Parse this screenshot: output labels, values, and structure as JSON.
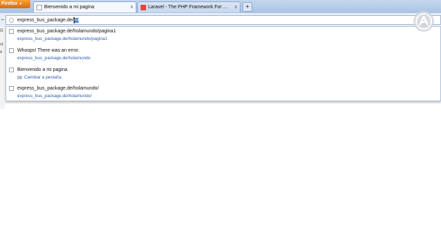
{
  "browser": {
    "menu_button": "Firefox",
    "tabs": [
      {
        "label": "Bienvenido a mi pagina",
        "active": true
      },
      {
        "label": "Laravel - The PHP Framework For We...",
        "active": false
      }
    ],
    "new_tab": "+",
    "close_glyph": "x"
  },
  "urlbar": {
    "typed_before": "express_bus_package.de/",
    "typed_selected": "ro"
  },
  "suggestions": [
    {
      "title": "express_bus_package.de/holamundo/pagina1",
      "url": "express_bus_package.de/holamundo/pagina1"
    },
    {
      "title": "Whoops! There was an error.",
      "url": "express_bus_package.de/holamundo"
    },
    {
      "title": "Bienvenido a mi pagina",
      "switch_tab": "Cambiar a pestaña"
    },
    {
      "title": "express_bus_package.de/holamundo/",
      "url": "express_bus_package.de/holamundo/"
    }
  ],
  "page_fragments": [
    "G",
    "st",
    "e"
  ],
  "colors": {
    "link": "#2a5db0",
    "selection": "#3d7bd6",
    "firefox_orange": "#e8842a"
  }
}
